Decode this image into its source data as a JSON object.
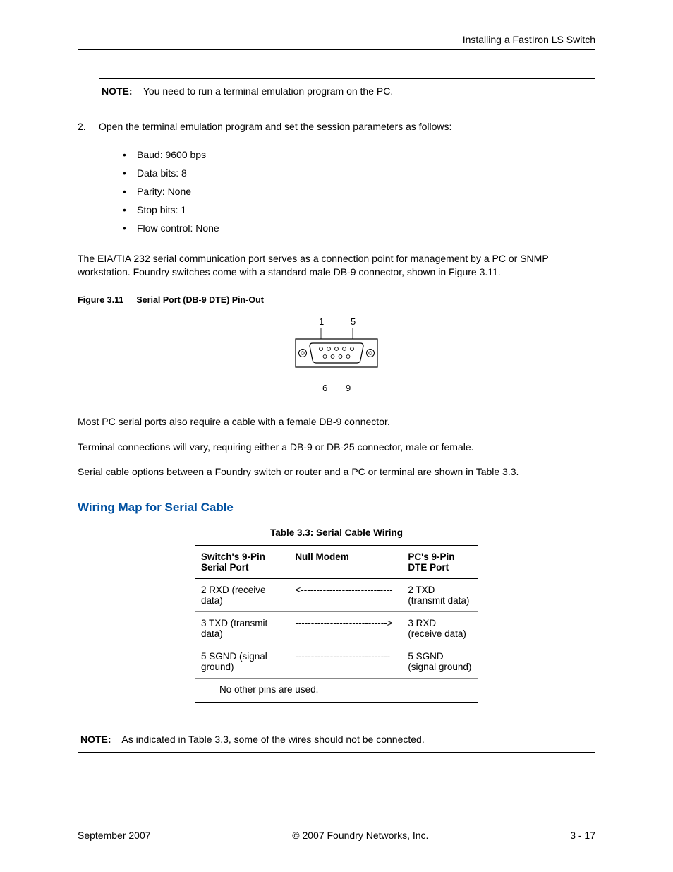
{
  "header": {
    "title": "Installing a FastIron LS Switch"
  },
  "note1": {
    "label": "NOTE:",
    "text": "You need to run a terminal emulation program on the PC."
  },
  "step": {
    "num": "2.",
    "text": "Open the terminal emulation program and set the session parameters as follows:"
  },
  "bullets": [
    "Baud:  9600 bps",
    "Data bits:  8",
    "Parity:  None",
    "Stop bits:  1",
    "Flow control:  None"
  ],
  "para1": "The EIA/TIA 232 serial communication port serves as a connection point for management by a PC or SNMP workstation.  Foundry switches come with a standard male DB-9 connector, shown in Figure 3.11.",
  "figure": {
    "label": "Figure 3.11",
    "title": "Serial Port (DB-9 DTE) Pin-Out",
    "pin1": "1",
    "pin5": "5",
    "pin6": "6",
    "pin9": "9"
  },
  "para2": "Most PC serial ports also require a cable with a female DB-9 connector.",
  "para3": "Terminal connections will vary, requiring either a DB-9 or DB-25 connector, male or female.",
  "para4": "Serial cable options between a Foundry switch or router and a PC or terminal are shown in Table 3.3.",
  "section_heading": "Wiring Map for Serial Cable",
  "table": {
    "caption": "Table 3.3: Serial Cable Wiring",
    "head": [
      "Switch's 9-Pin Serial Port",
      "Null Modem",
      "PC's 9-Pin DTE Port"
    ],
    "rows": [
      [
        "2 RXD (receive data)",
        "<-----------------------------",
        "2 TXD (transmit data)"
      ],
      [
        "3 TXD (transmit data)",
        "----------------------------->",
        "3 RXD (receive data)"
      ],
      [
        "5 SGND (signal ground)",
        "------------------------------",
        "5 SGND (signal ground)"
      ]
    ],
    "footnote": "No other pins are used."
  },
  "note2": {
    "label": "NOTE:",
    "text": "As indicated in Table 3.3, some of the wires should not be connected."
  },
  "footer": {
    "left": "September 2007",
    "center": "© 2007 Foundry Networks, Inc.",
    "right": "3 - 17"
  }
}
